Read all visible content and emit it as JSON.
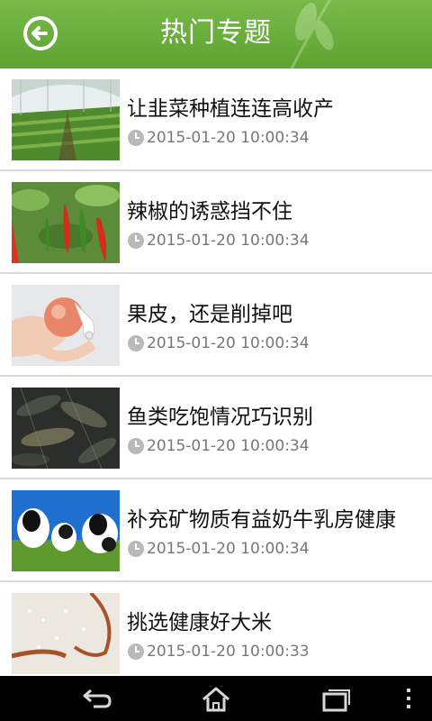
{
  "header": {
    "title": "热门专题",
    "back_icon": "back-arrow-circle-icon"
  },
  "items": [
    {
      "title": "让韭菜种植连连高收产",
      "time": "2015-01-20 10:00:34",
      "thumb": "greenhouse-chives"
    },
    {
      "title": "辣椒的诱惑挡不住",
      "time": "2015-01-20 10:00:34",
      "thumb": "red-peppers"
    },
    {
      "title": "果皮，还是削掉吧",
      "time": "2015-01-20 10:00:34",
      "thumb": "peeling-apple"
    },
    {
      "title": "鱼类吃饱情况巧识别",
      "time": "2015-01-20 10:00:34",
      "thumb": "fish-in-pond"
    },
    {
      "title": "补充矿物质有益奶牛乳房健康",
      "time": "2015-01-20 10:00:34",
      "thumb": "dairy-cows"
    },
    {
      "title": "挑选健康好大米",
      "time": "2015-01-20 10:00:33",
      "thumb": "rice-grains"
    }
  ],
  "navbar": {
    "icons": [
      "back-icon",
      "home-icon",
      "recent-apps-icon",
      "menu-icon"
    ]
  },
  "colors": {
    "header_green": "#68ac3a",
    "time_gray": "#777777",
    "divider": "#d9d9d9"
  }
}
